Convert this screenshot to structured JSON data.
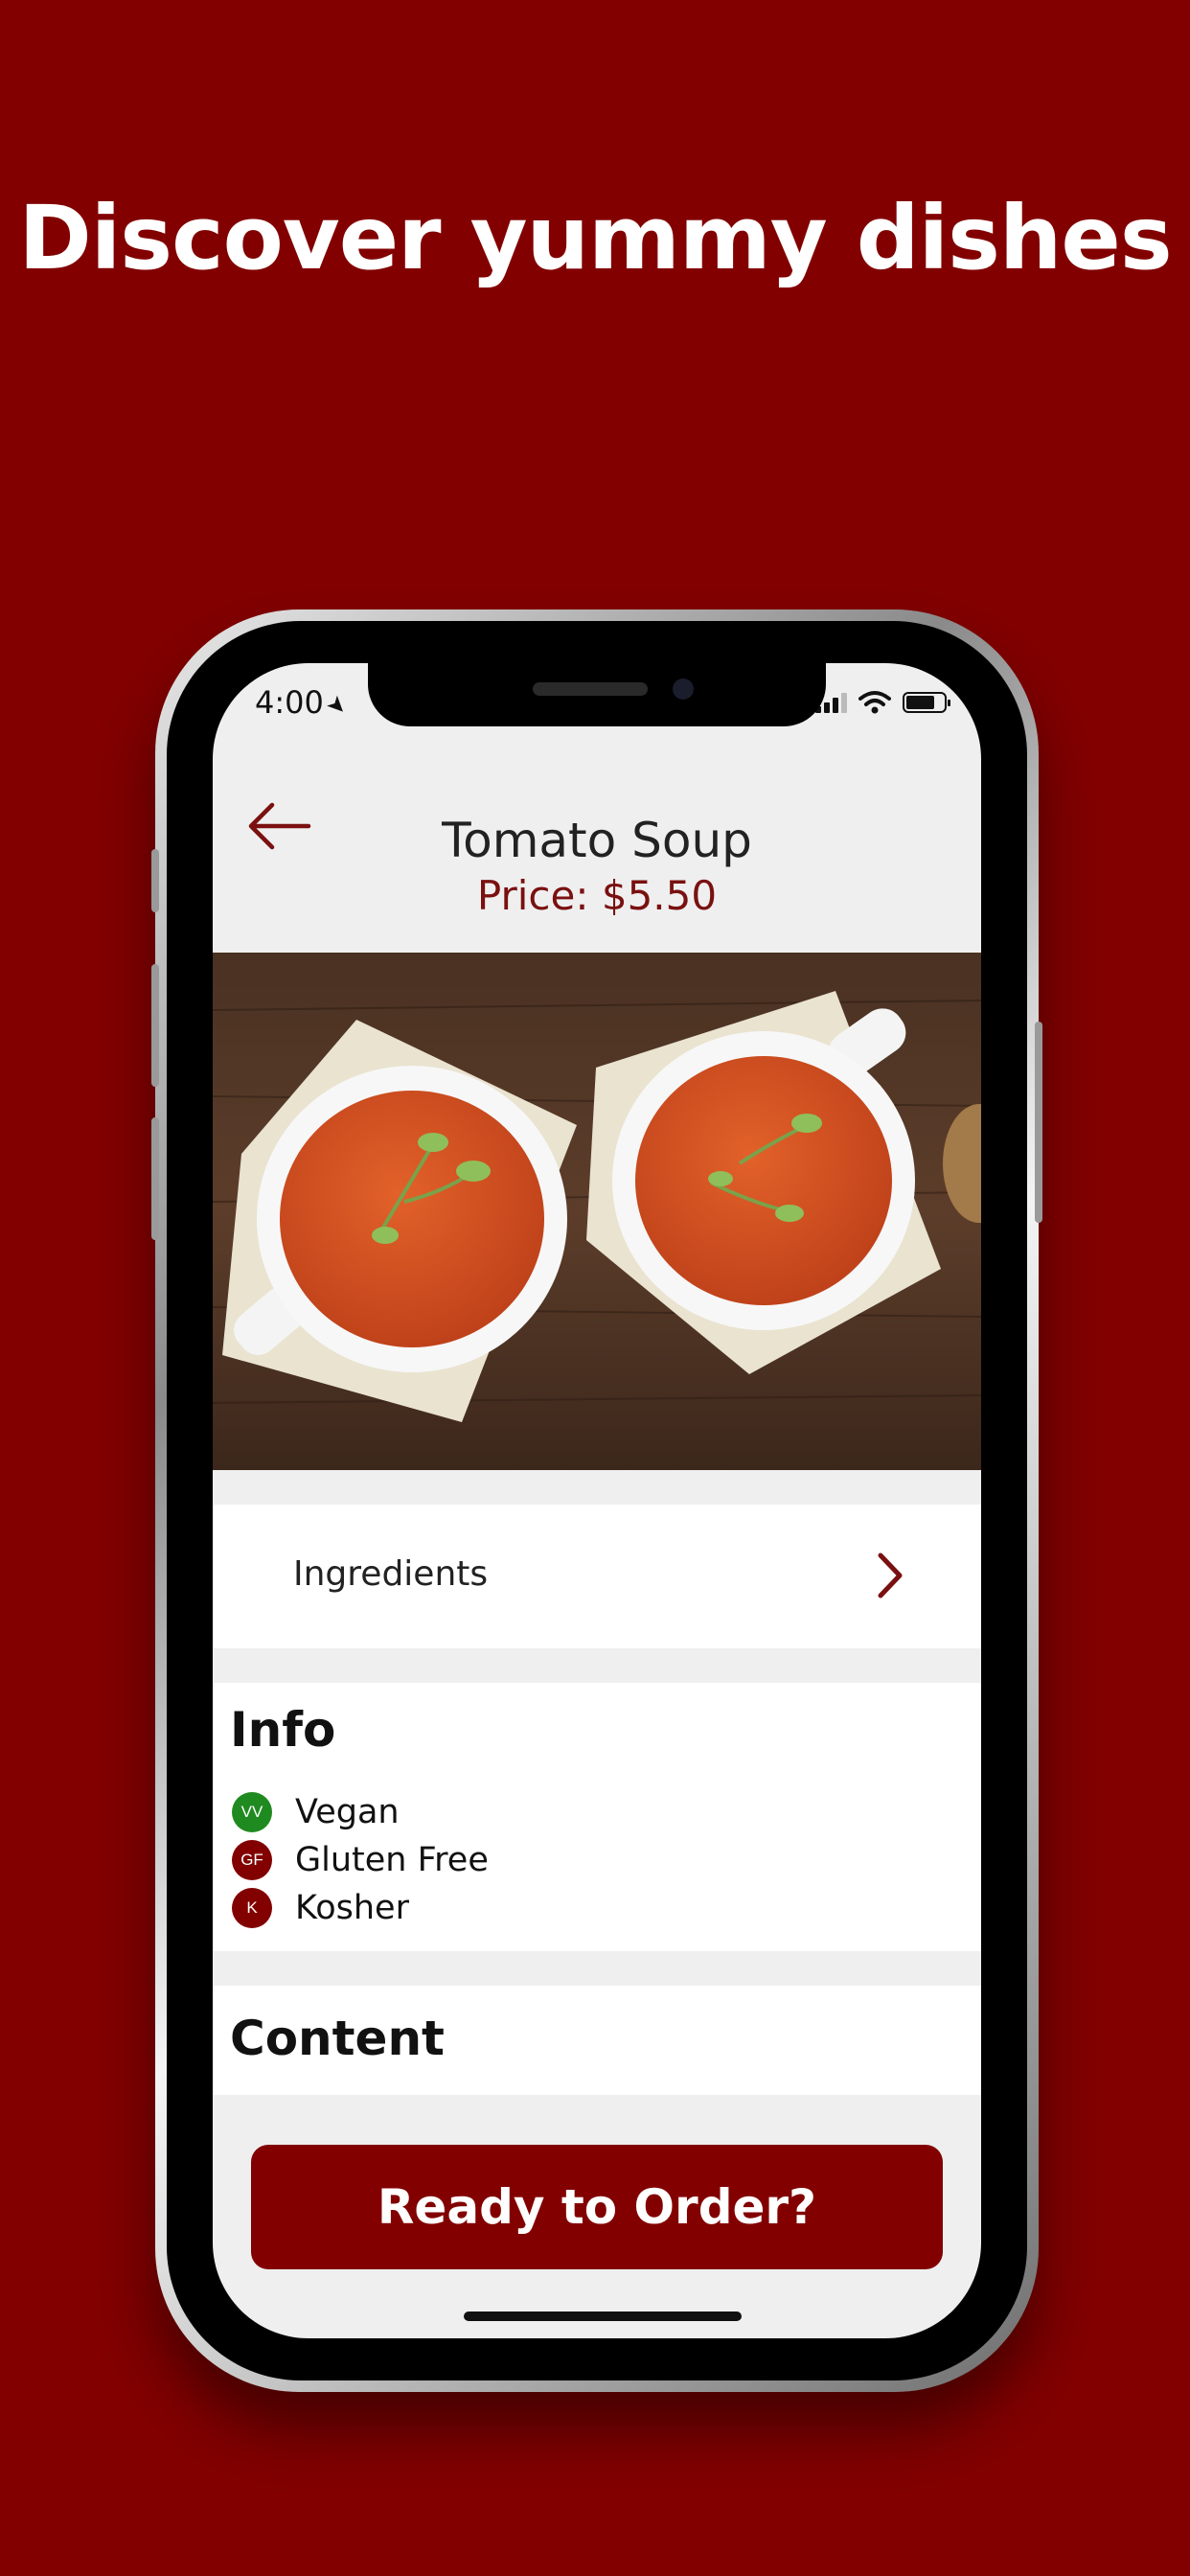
{
  "headline": "Discover yummy dishes",
  "status_bar": {
    "time": "4:00"
  },
  "nav": {
    "title": "Tomato Soup"
  },
  "price": "Price: $5.50",
  "ingredients": {
    "label": "Ingredients"
  },
  "info": {
    "title": "Info",
    "items": [
      {
        "badge": "VV",
        "label": "Vegan",
        "color": "#1f8a1f"
      },
      {
        "badge": "GF",
        "label": "Gluten Free",
        "color": "#820000"
      },
      {
        "badge": "K",
        "label": "Kosher",
        "color": "#820000"
      }
    ]
  },
  "content": {
    "title": "Content"
  },
  "order_button": {
    "label": "Ready to Order?"
  },
  "colors": {
    "brand": "#820000",
    "vegan": "#1f8a1f"
  }
}
